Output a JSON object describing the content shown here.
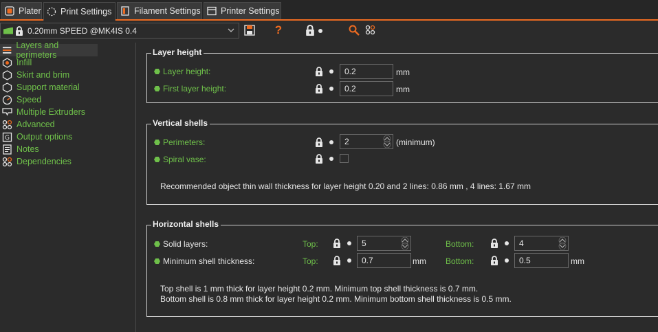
{
  "tabs": [
    {
      "label": "Plater",
      "icon": "plater-icon"
    },
    {
      "label": "Print Settings",
      "icon": "print-settings-icon"
    },
    {
      "label": "Filament Settings",
      "icon": "filament-icon"
    },
    {
      "label": "Printer Settings",
      "icon": "printer-icon"
    }
  ],
  "preset": {
    "name": "0.20mm SPEED @MK4IS 0.4"
  },
  "toolbar": {
    "help_label": "?"
  },
  "sidebar": {
    "items": [
      {
        "label": "Layers and perimeters",
        "icon": "layers-icon"
      },
      {
        "label": "Infill",
        "icon": "infill-icon"
      },
      {
        "label": "Skirt and brim",
        "icon": "skirt-icon"
      },
      {
        "label": "Support material",
        "icon": "support-icon"
      },
      {
        "label": "Speed",
        "icon": "speed-icon"
      },
      {
        "label": "Multiple Extruders",
        "icon": "extruders-icon"
      },
      {
        "label": "Advanced",
        "icon": "advanced-icon"
      },
      {
        "label": "Output options",
        "icon": "output-icon"
      },
      {
        "label": "Notes",
        "icon": "notes-icon"
      },
      {
        "label": "Dependencies",
        "icon": "dependencies-icon"
      }
    ]
  },
  "layer_height": {
    "title": "Layer height",
    "layer_height_label": "Layer height:",
    "layer_height_value": "0.2",
    "first_layer_label": "First layer height:",
    "first_layer_value": "0.2",
    "unit": "mm"
  },
  "vertical_shells": {
    "title": "Vertical shells",
    "perimeters_label": "Perimeters:",
    "perimeters_value": "2",
    "perimeters_suffix": "(minimum)",
    "spiral_label": "Spiral vase:",
    "recommendation": "Recommended object thin wall thickness for layer height 0.20 and 2 lines: 0.86 mm , 4 lines: 1.67 mm"
  },
  "horizontal_shells": {
    "title": "Horizontal shells",
    "solid_layers_label": "Solid layers:",
    "min_thickness_label": "Minimum shell thickness:",
    "top_label": "Top:",
    "bottom_label": "Bottom:",
    "solid_top_value": "5",
    "solid_bottom_value": "4",
    "min_top_value": "0.7",
    "min_bottom_value": "0.5",
    "unit": "mm",
    "note_top": "Top shell is 1 mm thick for layer height 0.2 mm. Minimum top shell thickness is 0.7 mm.",
    "note_bottom": "Bottom shell is 0.8 mm thick for layer height 0.2 mm. Minimum bottom shell thickness is 0.5 mm."
  },
  "colors": {
    "accent": "#ed6b21",
    "label_green": "#6fc04a",
    "background": "#2b2b2b"
  }
}
